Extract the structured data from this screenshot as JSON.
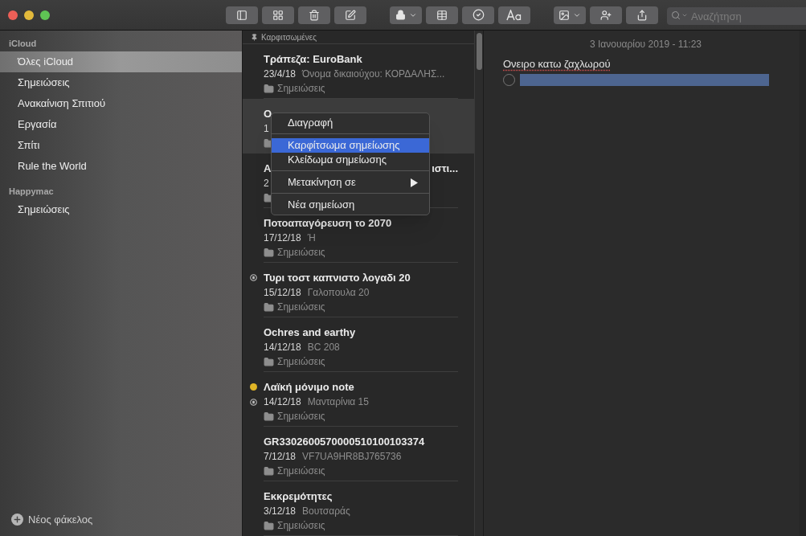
{
  "toolbar": {
    "search": {
      "placeholder": "Αναζήτηση"
    }
  },
  "sidebar": {
    "groups": [
      {
        "title": "iCloud",
        "items": [
          {
            "label": "Όλες iCloud",
            "selected": true
          },
          {
            "label": "Σημειώσεις",
            "selected": false
          },
          {
            "label": "Ανακαίνιση Σπιτιού",
            "selected": false
          },
          {
            "label": "Εργασία",
            "selected": false
          },
          {
            "label": "Σπίτι",
            "selected": false
          },
          {
            "label": "Rule the World",
            "selected": false
          }
        ]
      },
      {
        "title": "Happymac",
        "items": [
          {
            "label": "Σημειώσεις",
            "selected": false
          }
        ]
      }
    ],
    "new_folder": "Νέος φάκελος"
  },
  "note_list": {
    "pinned_header": "Καρφιτσωμένες",
    "notes": [
      {
        "title": "Τράπεζα: EuroBank",
        "date": "23/4/18",
        "snippet": "Όνομα δικαιούχου: ΚΟΡΔΑΛΗΣ...",
        "folder": "Σημειώσεις",
        "selected": false,
        "locked": false
      },
      {
        "title": "Ο",
        "date": "1",
        "selected": true,
        "locked": false
      },
      {
        "title": "Α",
        "title_tail": "ιστι...",
        "date": "2",
        "selected": false,
        "locked": false
      },
      {
        "title": "Ποτοαπαγόρευση το 2070",
        "date": "17/12/18",
        "snippet": "Ή",
        "folder": "Σημειώσεις",
        "selected": false,
        "locked": false
      },
      {
        "title": "Τυρι τοστ καπνιστο λογαδι 20",
        "date": "15/12/18",
        "snippet": "Γαλοπουλα 20",
        "folder": "Σημειώσεις",
        "selected": false,
        "locked": true
      },
      {
        "title": "Ochres and earthy",
        "date": "14/12/18",
        "snippet": "BC 208",
        "folder": "Σημειώσεις",
        "selected": false,
        "locked": false
      },
      {
        "title": "Λαϊκή μόνιμο note",
        "date": "14/12/18",
        "snippet": "Μανταρίνια 15",
        "folder": "Σημειώσεις",
        "selected": false,
        "locked": true,
        "color": "#e0b526"
      },
      {
        "title": "GR3302600570000510100103374",
        "date": "7/12/18",
        "snippet": "VF7UA9HR8BJ765736",
        "folder": "Σημειώσεις",
        "selected": false,
        "locked": false
      },
      {
        "title": "Εκκρεμότητες",
        "date": "3/12/18",
        "snippet": "Βουτσαράς",
        "folder": "Σημειώσεις",
        "selected": false,
        "locked": false
      }
    ]
  },
  "context_menu": {
    "items": [
      {
        "label": "Διαγραφή",
        "selected": false,
        "submenu": false,
        "separator_before": false
      },
      {
        "label": "Καρφίτσωμα σημείωσης",
        "selected": true,
        "submenu": false,
        "separator_before": true
      },
      {
        "label": "Κλείδωμα σημείωσης",
        "selected": false,
        "submenu": false,
        "separator_before": false
      },
      {
        "label": "Μετακίνηση σε",
        "selected": false,
        "submenu": true,
        "separator_before": true
      },
      {
        "label": "Νέα σημείωση",
        "selected": false,
        "submenu": false,
        "separator_before": true
      }
    ]
  },
  "editor": {
    "timestamp": "3 Ιανουαρίου 2019 - 11:23",
    "title": "Ονειρο κατω ζαχλωρού",
    "checklist": [
      {
        "checked": false,
        "selected": true
      }
    ]
  }
}
